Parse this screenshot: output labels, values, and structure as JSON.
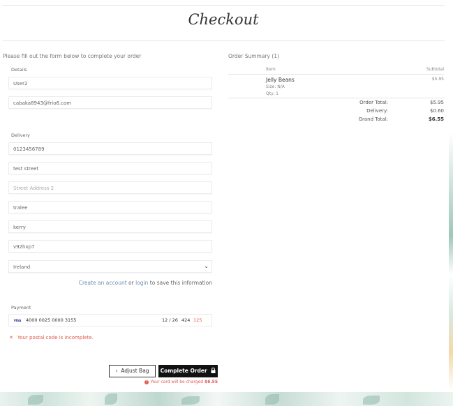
{
  "page": {
    "title": "Checkout",
    "intro": "Please fill out the form below to complete your order"
  },
  "details": {
    "label": "Details",
    "username": "User2",
    "email": "cabaka8943@frio6.com"
  },
  "delivery": {
    "label": "Delivery",
    "phone": "0123456789",
    "street1": "test street",
    "street2_placeholder": "Street Address 2",
    "town": "tralee",
    "county": "kerry",
    "postcode": "v92hxp7",
    "country": "Ireland"
  },
  "save_info": {
    "create": "Create an account",
    "or": "or",
    "login": "login",
    "rest": "to save this information"
  },
  "payment": {
    "label": "Payment",
    "brand": "VISA",
    "card_number": "4000 0025 0000 3155",
    "expiry": "12 / 26",
    "cvc": "424",
    "postal": "125",
    "error": "Your postal code is incomplete."
  },
  "actions": {
    "adjust_bag": "Adjust Bag",
    "complete_order": "Complete Order",
    "charge_note": "Your card will be charged",
    "charge_amount": "$6.55"
  },
  "summary": {
    "title": "Order Summary (1)",
    "col_item": "Item",
    "col_subtotal": "Subtotal",
    "items": [
      {
        "name": "Jelly Beans",
        "size": "Size: N/A",
        "qty": "Qty: 1",
        "price": "$5.95"
      }
    ],
    "order_total_label": "Order Total:",
    "order_total": "$5.95",
    "delivery_label": "Delivery:",
    "delivery": "$0.60",
    "grand_total_label": "Grand Total:",
    "grand_total": "$6.55"
  }
}
